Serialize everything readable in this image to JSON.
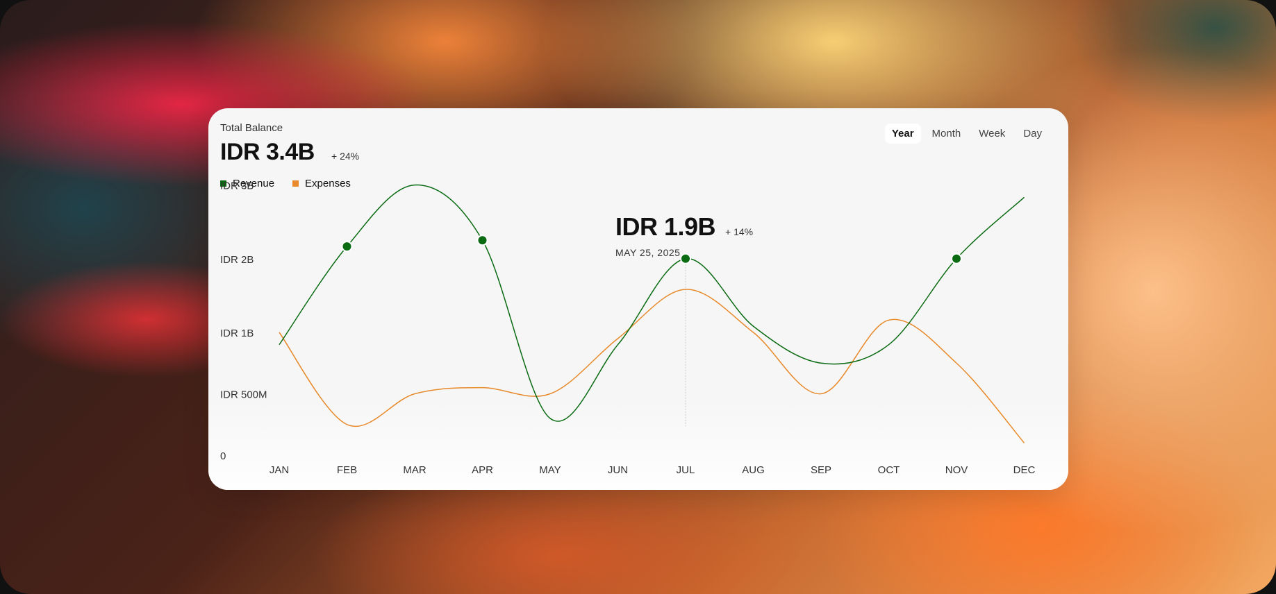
{
  "header": {
    "title": "Total Balance",
    "balance": "IDR 3.4B",
    "balance_change": "+ 24%"
  },
  "tabs": [
    {
      "label": "Year",
      "active": true
    },
    {
      "label": "Month",
      "active": false
    },
    {
      "label": "Week",
      "active": false
    },
    {
      "label": "Day",
      "active": false
    }
  ],
  "legend": [
    {
      "label": "Revenue",
      "color": "#0a6b12"
    },
    {
      "label": "Expenses",
      "color": "#e8892a"
    }
  ],
  "tooltip": {
    "value": "IDR 1.9B",
    "change": "+ 14%",
    "date": "MAY 25, 2025"
  },
  "chart_data": {
    "type": "line",
    "categories": [
      "JAN",
      "FEB",
      "MAR",
      "APR",
      "MAY",
      "JUN",
      "JUL",
      "AUG",
      "SEP",
      "OCT",
      "NOV",
      "DEC"
    ],
    "y_ticks": [
      {
        "label": "0",
        "value": 0
      },
      {
        "label": "IDR 500M",
        "value": 0.5
      },
      {
        "label": "IDR 1B",
        "value": 1.0
      },
      {
        "label": "IDR 2B",
        "value": 1.6
      },
      {
        "label": "IDR 3B",
        "value": 2.2
      }
    ],
    "ylim": [
      0,
      2.2
    ],
    "series": [
      {
        "name": "Revenue",
        "color": "#0a6b12",
        "values": [
          0.9,
          1.7,
          2.2,
          1.75,
          0.3,
          0.9,
          1.6,
          1.05,
          0.75,
          0.9,
          1.6,
          2.1
        ],
        "markers": [
          1,
          3,
          6,
          10
        ]
      },
      {
        "name": "Expenses",
        "color": "#e8892a",
        "values": [
          1.0,
          0.25,
          0.5,
          0.55,
          0.5,
          0.95,
          1.35,
          1.0,
          0.5,
          1.1,
          0.75,
          0.1
        ]
      }
    ],
    "highlight_index": 6
  }
}
